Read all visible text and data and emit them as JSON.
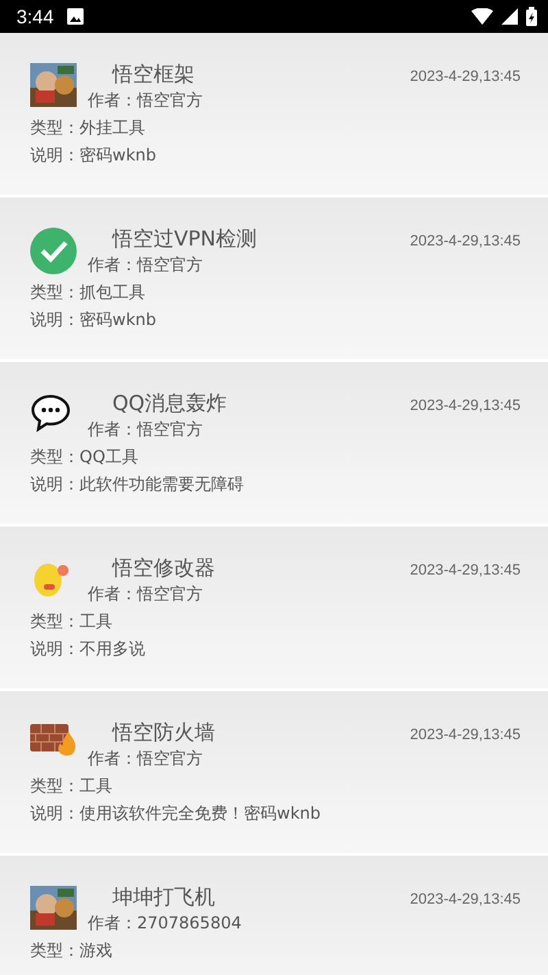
{
  "status_bar": {
    "time": "3:44"
  },
  "apps": [
    {
      "kind": "picture",
      "title": "悟空框架",
      "date": "2023-4-29,13:45",
      "author": "作者：悟空官方",
      "type": "类型：外挂工具",
      "note": "说明：密码wknb"
    },
    {
      "kind": "check",
      "title": "悟空过VPN检测",
      "date": "2023-4-29,13:45",
      "author": "作者：悟空官方",
      "type": "类型：抓包工具",
      "note": "说明：密码wknb"
    },
    {
      "kind": "chat",
      "title": "QQ消息轰炸",
      "date": "2023-4-29,13:45",
      "author": "作者：悟空官方",
      "type": "类型：QQ工具",
      "note": "说明：此软件功能需要无障碍"
    },
    {
      "kind": "emoji",
      "title": "悟空修改器",
      "date": "2023-4-29,13:45",
      "author": "作者：悟空官方",
      "type": "类型：工具",
      "note": "说明：不用多说"
    },
    {
      "kind": "firewall",
      "title": "悟空防火墙",
      "date": "2023-4-29,13:45",
      "author": "作者：悟空官方",
      "type": "类型：工具",
      "note": "说明：使用该软件完全免费！密码wknb"
    },
    {
      "kind": "picture",
      "title": "坤坤打飞机",
      "date": "2023-4-29,13:45",
      "author": "作者：2707865804",
      "type": "类型：游戏"
    }
  ]
}
